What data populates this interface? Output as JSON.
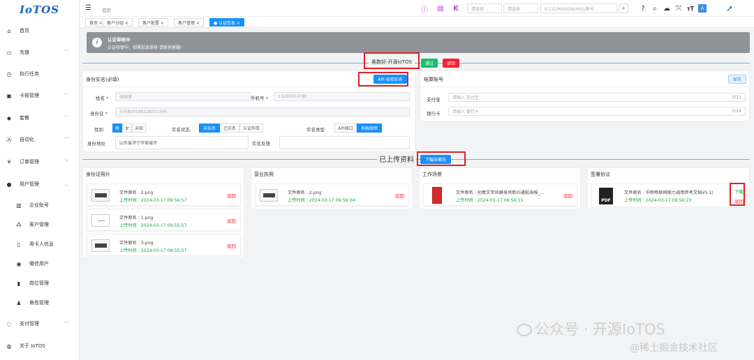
{
  "app": {
    "logo": "IoTOS"
  },
  "sidebar": {
    "items": [
      {
        "label": "首页",
        "icon": "home-icon",
        "glyph": "⌂",
        "arrow": false
      },
      {
        "label": "充值",
        "icon": "cart-icon",
        "glyph": "▭",
        "arrow": true
      },
      {
        "label": "执行任务",
        "icon": "task-icon",
        "glyph": "◷",
        "arrow": false
      },
      {
        "label": "卡板管理",
        "icon": "card-icon",
        "glyph": "▣",
        "arrow": true
      },
      {
        "label": "套餐",
        "icon": "package-icon",
        "glyph": "◆",
        "arrow": true
      },
      {
        "label": "自动化",
        "icon": "automation-icon",
        "glyph": "Ⓐ",
        "arrow": true
      },
      {
        "label": "订单管理",
        "icon": "yen-icon",
        "glyph": "¥",
        "arrow": true
      },
      {
        "label": "用户管理",
        "icon": "user-icon",
        "glyph": "●",
        "arrow": true,
        "expanded": true
      },
      {
        "label": "企业账号",
        "icon": "enterprise-icon",
        "glyph": "▥",
        "sub": true
      },
      {
        "label": "客户管理",
        "icon": "customer-icon",
        "glyph": "⁂",
        "sub": true
      },
      {
        "label": "用卡人信息",
        "icon": "phone-icon",
        "glyph": "▯",
        "sub": true
      },
      {
        "label": "微信用户",
        "icon": "wechat-icon",
        "glyph": "◉",
        "sub": true
      },
      {
        "label": "岗位管理",
        "icon": "post-icon",
        "glyph": "▮",
        "sub": true
      },
      {
        "label": "角色管理",
        "icon": "role-icon",
        "glyph": "♟",
        "sub": true
      },
      {
        "label": "支付管理",
        "icon": "pay-icon",
        "glyph": "◌",
        "arrow": true
      },
      {
        "label": "关于 IoTOS",
        "icon": "about-icon",
        "glyph": "◍",
        "arrow": false
      }
    ]
  },
  "header": {
    "breadcrumb": "首页",
    "selects": [
      "请选择",
      "请选择",
      "ICCID/MSISDN/IMSI/备号"
    ]
  },
  "tabs": [
    "首页 ×",
    "客户分组 ×",
    "客户配置 ×",
    "客户管理 ×",
    "● 认证信息 ×"
  ],
  "alert": {
    "title": "认证审核中",
    "desc": "认证待审中，如需加急审核 请联系客服!"
  },
  "review": {
    "name": "奥数好-开源IoTOS",
    "pass": "通过",
    "reject": "驳回"
  },
  "idcard": {
    "title": "身份实名(必填)",
    "api_button": "API 校验实名",
    "name_label": "姓名",
    "name_value": "张国荣",
    "phone_label": "手机号",
    "phone_value": "13200014780",
    "idno_label": "身份证",
    "idno_value": "370803199218231595",
    "gender_label": "性别",
    "gender_options": [
      "男",
      "女",
      "未知"
    ],
    "status_label": "实名状态",
    "status_options": [
      "未实名",
      "已实名",
      "认证失败"
    ],
    "type_label": "实名类型",
    "type_options": [
      "API接口",
      "系统校验"
    ],
    "address_label": "身份地址",
    "address_value": "山东省济宁市邹城市",
    "feedback_label": "实名反馈"
  },
  "settlement": {
    "title": "结算账号",
    "save": "保存",
    "alipay_label": "支付宝",
    "alipay_placeholder": "请输入 支付宝",
    "alipay_count": "0/11",
    "bank_label": "银行卡",
    "bank_placeholder": "请输入 银行卡",
    "bank_count": "0/24"
  },
  "uploaded": {
    "title": "已上传资料",
    "download": "下载压缩包"
  },
  "groups": [
    {
      "title": "身份证照片",
      "files": [
        {
          "name": "文件原名 : 2.png",
          "time": "上传时间 : 2024-03-17 09:56:57",
          "reject": "驳回"
        },
        {
          "name": "文件原名 : 1.png",
          "time": "上传时间 : 2024-03-17 09:55:57",
          "reject": "驳回"
        },
        {
          "name": "文件原名 : 3.png",
          "time": "上传时间 : 2024-03-17 09:55:57",
          "reject": "驳回"
        }
      ]
    },
    {
      "title": "营业执照",
      "files": [
        {
          "name": "文件原名 : 2.png",
          "time": "上传时间 : 2024-03-17 09:56:04",
          "reject": "驳回"
        }
      ]
    },
    {
      "title": "工作场景",
      "files": [
        {
          "name": "文件原名 : 创意文字风健身房新价通知海报_...",
          "time": "上传时间 : 2024-03-17 09:56:15",
          "reject": "驳回"
        }
      ]
    },
    {
      "title": "签署协议",
      "files": [
        {
          "name": "文件原名 : 中移物联网能力调用参考文档V5.1(",
          "time": "上传时间 : 2024-03-17 09:56:23",
          "download": "下载",
          "reject": "驳回"
        }
      ]
    }
  ],
  "watermark": {
    "line1": "公众号 · 开源IoTOS",
    "line2": "@稀土掘金技术社区"
  },
  "colors": {
    "primary": "#1890ff",
    "success": "#19be6b",
    "danger": "#f5222d",
    "alert_bg": "#8f9399"
  }
}
